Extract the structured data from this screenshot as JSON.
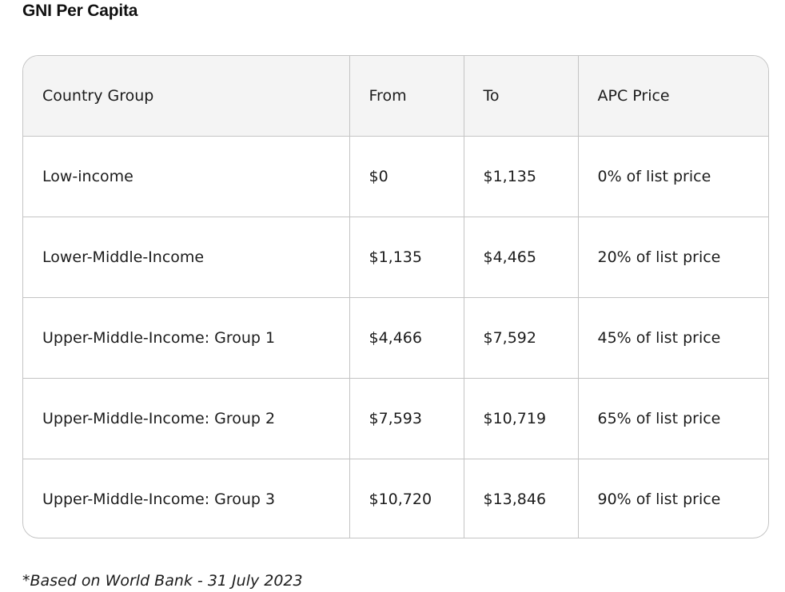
{
  "title": "GNI Per Capita",
  "table": {
    "headers": [
      "Country Group",
      "From",
      "To",
      "APC Price"
    ],
    "rows": [
      [
        "Low-income",
        "$0",
        "$1,135",
        "0% of list price"
      ],
      [
        "Lower-Middle-Income",
        "$1,135",
        "$4,465",
        "20% of list price"
      ],
      [
        "Upper-Middle-Income: Group 1",
        "$4,466",
        "$7,592",
        "45% of list price"
      ],
      [
        "Upper-Middle-Income: Group 2",
        "$7,593",
        "$10,719",
        "65% of list price"
      ],
      [
        "Upper-Middle-Income: Group 3",
        "$10,720",
        "$13,846",
        "90% of list price"
      ]
    ]
  },
  "footnote": "*Based on World Bank - 31 July 2023",
  "colors": {
    "header_bg": "#f4f4f4",
    "border": "#c4c4c4",
    "text": "#1c1c1c"
  }
}
